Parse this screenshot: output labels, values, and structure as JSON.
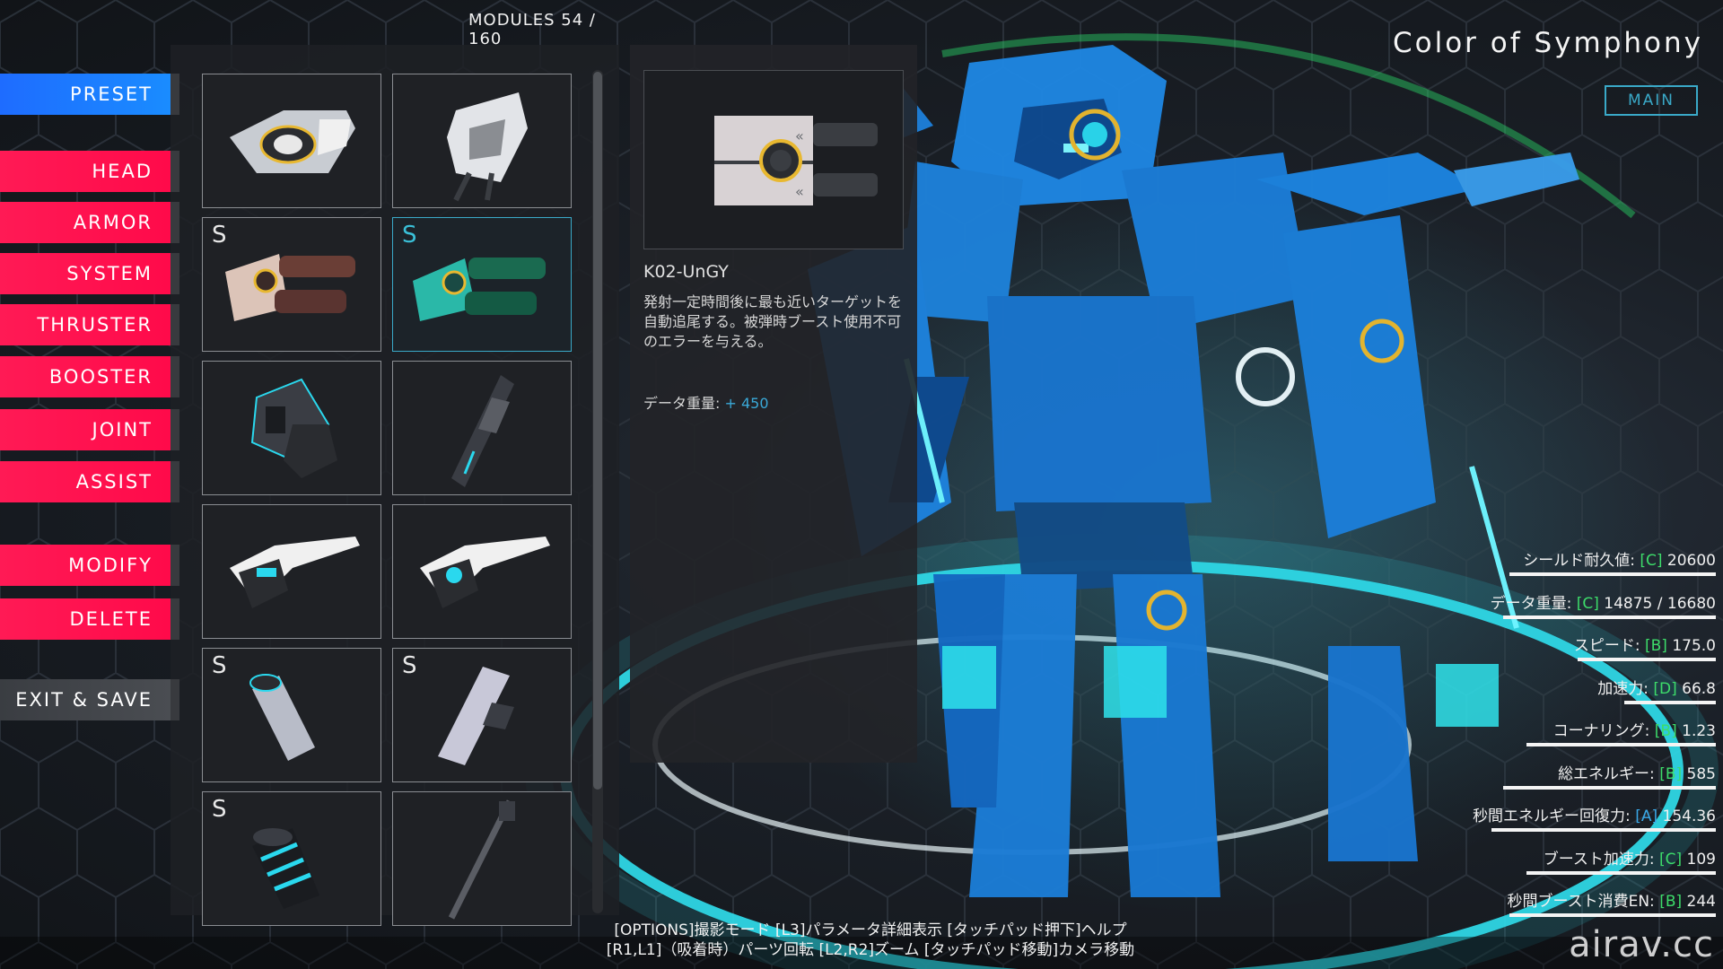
{
  "header": {
    "modules_counter": "MODULES 54 / 160"
  },
  "nav": {
    "preset": "PRESET",
    "head": "HEAD",
    "armor": "ARMOR",
    "system": "SYSTEM",
    "thruster": "THRUSTER",
    "booster": "BOOSTER",
    "joint": "JOINT",
    "assist": "ASSIST",
    "modify": "MODIFY",
    "delete": "DELETE",
    "exit_save": "EXIT & SAVE"
  },
  "parts": [
    {
      "rank": "",
      "icon": "armor-plate-icon",
      "color": "#d0d3d8"
    },
    {
      "rank": "",
      "icon": "white-cannon-icon",
      "color": "#e0e2e6"
    },
    {
      "rank": "S",
      "icon": "twin-launcher-brown-icon",
      "color": "#7a4a3f"
    },
    {
      "rank": "S",
      "icon": "twin-launcher-green-icon",
      "color": "#2a8a6a",
      "selected": true
    },
    {
      "rank": "",
      "icon": "dark-module-icon",
      "color": "#3a3d44"
    },
    {
      "rank": "",
      "icon": "long-rifle-icon",
      "color": "#4a4d54"
    },
    {
      "rank": "",
      "icon": "wing-thruster-icon",
      "color": "#f0f0f0"
    },
    {
      "rank": "",
      "icon": "wing-thruster-blue-icon",
      "color": "#f0f0f0"
    },
    {
      "rank": "S",
      "icon": "cylinder-icon",
      "color": "#b8bcc8"
    },
    {
      "rank": "S",
      "icon": "blade-plate-icon",
      "color": "#c8c8d8"
    },
    {
      "rank": "S",
      "icon": "striped-cylinder-icon",
      "color": "#2ac0d8"
    },
    {
      "rank": "",
      "icon": "thin-rod-icon",
      "color": "#5a5d64"
    }
  ],
  "detail": {
    "name": "K02-UnGY",
    "description": "発射一定時間後に最も近いターゲットを自動追尾する。被弾時ブースト使用不可のエラーを与える。",
    "weight_label": "データ重量:",
    "weight_value": "+ 450",
    "preview_icon": "twin-launcher-icon"
  },
  "mech": {
    "title": "Color of Symphony",
    "badge": "MAIN"
  },
  "stats": [
    {
      "label": "シールド耐久値:",
      "grade": "[C]",
      "value": "20600",
      "fill": 0.36
    },
    {
      "label": "データ重量:",
      "grade": "[C]",
      "value": "14875 / 16680",
      "fill": 0.37
    },
    {
      "label": "スピード:",
      "grade": "[B]",
      "value": "175.0",
      "fill": 0.24
    },
    {
      "label": "加速力:",
      "grade": "[D]",
      "value": "66.8",
      "fill": 0.16
    },
    {
      "label": "コーナリング:",
      "grade": "[B]",
      "value": "1.23",
      "fill": 0.33
    },
    {
      "label": "総エネルギー:",
      "grade": "[B]",
      "value": "585",
      "fill": 0.37
    },
    {
      "label": "秒間エネルギー回復力:",
      "grade": "[A]",
      "value": "154.36",
      "fill": 0.39
    },
    {
      "label": "ブースト加速力:",
      "grade": "[C]",
      "value": "109",
      "fill": 0.33
    },
    {
      "label": "秒間ブースト消費EN:",
      "grade": "[B]",
      "value": "244",
      "fill": 0.36
    }
  ],
  "help": {
    "line1": "[OPTIONS]撮影モード [L3]パラメータ詳細表示 [タッチパッド押下]ヘルプ",
    "line2": "[R1,L1]（吸着時）パーツ回転 [L2,R2]ズーム [タッチパッド移動]カメラ移動"
  },
  "watermark": "airav.cc",
  "colors": {
    "nav_red": "#ff0a4a",
    "nav_blue": "#1e6cff",
    "accent_cyan": "#3aa9c8",
    "grade_green": "#3ddc6a",
    "mech_blue": "#1a8ae8"
  }
}
